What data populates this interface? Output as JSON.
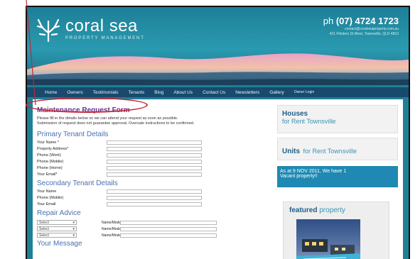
{
  "header": {
    "logo_name": "coral sea",
    "logo_sub": "PROPERTY MANAGEMENT",
    "phone_prefix": "ph",
    "phone_number": "(07) 4724 1723",
    "contact_line1": "contact@coralseaproperty.com.au",
    "contact_line2": "421 Flinders St West, Townsville, QLD 4810"
  },
  "nav": {
    "items": [
      "Home",
      "Owners",
      "Testimonials",
      "Tenants",
      "Blog",
      "About Us",
      "Contact Us",
      "Newsletters",
      "Gallery"
    ],
    "owner_login": "Owner Login"
  },
  "form": {
    "title": "Maintenance Request Form",
    "intro_line1": "Please fill in the details below so we can attend your request as soon as possible.",
    "intro_line2": "Submission of request does not guarantee approval. Oversale instructions to be confirmed.",
    "primary_heading": "Primary Tenant Details",
    "primary_fields": [
      "Your Name *",
      "Property Address*",
      "Phone (Work)",
      "Phone (Mobile)",
      "Phone (Home)",
      "Your Email*"
    ],
    "secondary_heading": "Secondary Tenant Details",
    "secondary_fields": [
      "Your Name",
      "Phone (Mobile)",
      "Your Email"
    ],
    "repair_heading": "Repair Advice",
    "repair_select_value": "Select",
    "repair_label": "Name/Model",
    "message_heading": "Your Message"
  },
  "sidebar": {
    "houses_title": "Houses",
    "houses_sub": "for Rent Townsville",
    "units_title": "Units",
    "units_sub": "for Rent Townsville",
    "vacant_line1": "As at 9 NOV 2011, We have 1",
    "vacant_line2": "Vacant property!!",
    "featured_bold": "featured",
    "featured_rest": "property"
  },
  "colors": {
    "header_teal": "#1f7f95",
    "nav_dark": "#174a6c",
    "form_title_purple": "#6b2f8a",
    "annotation_red": "#c62637"
  }
}
